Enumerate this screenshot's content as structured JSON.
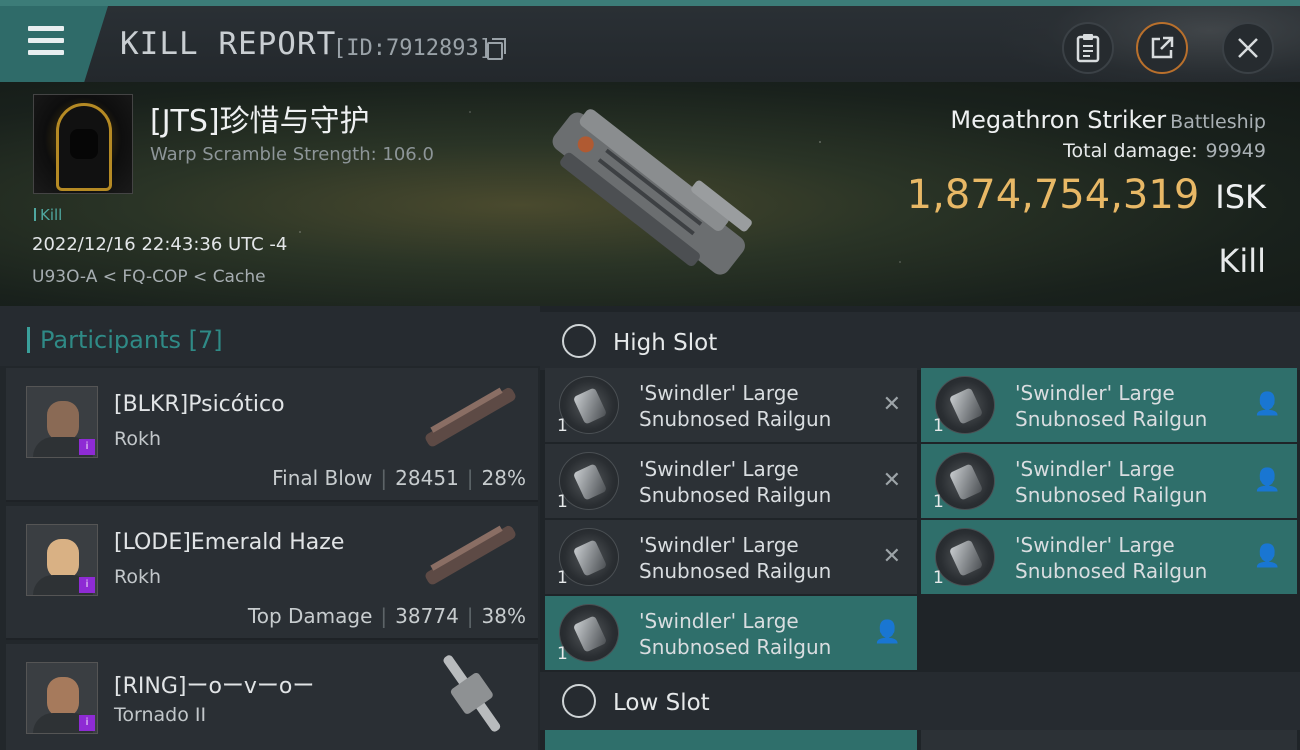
{
  "window": {
    "title": "KILL REPORT",
    "id_label": "[ID:7912893]"
  },
  "victim": {
    "name": "[JTS]珍惜与守护",
    "warp_scramble": "Warp Scramble Strength: 106.0",
    "tag": "Kill",
    "datetime": "2022/12/16 22:43:36 UTC -4",
    "location": "U93O-A < FQ-COP < Cache"
  },
  "ship": {
    "name": "Megathron Striker",
    "class": "Battleship",
    "damage_label": "Total damage:",
    "damage_value": "99949",
    "isk_value": "1,874,754,319",
    "isk_unit": "ISK",
    "kind": "Kill"
  },
  "participants": {
    "title": "Participants",
    "count": "[7]",
    "items": [
      {
        "name": "[BLKR]Psicótico",
        "ship": "Rokh",
        "role": "Final Blow",
        "damage": "28451",
        "percent": "28%"
      },
      {
        "name": "[LODE]Emerald Haze",
        "ship": "Rokh",
        "role": "Top Damage",
        "damage": "38774",
        "percent": "38%"
      },
      {
        "name": "[RING]ーoーvーoー",
        "ship": "Tornado II",
        "role": "",
        "damage": "",
        "percent": ""
      }
    ]
  },
  "fitting": {
    "high_slot_label": "High Slot",
    "low_slot_label": "Low Slot",
    "module_line1": "'Swindler' Large",
    "module_line2": "Snubnosed Railgun",
    "qty": "1",
    "icons": {
      "destroyed": "x-icon",
      "dropped": "person-icon"
    }
  },
  "colors": {
    "accent": "#2f6b69",
    "isk": "#e8b866",
    "teal_module": "#2f6f6b",
    "kill_tag": "#4fa7a0"
  }
}
